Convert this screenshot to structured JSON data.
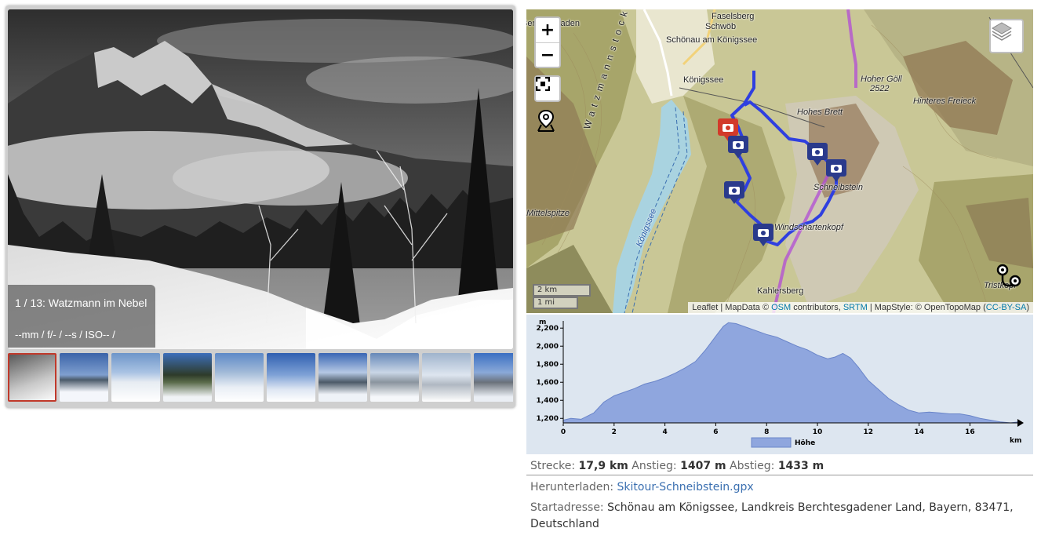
{
  "gallery": {
    "caption_title": "1 / 13: Watzmann im Nebel",
    "caption_meta": "--mm / f/- / --s / ISO-- /",
    "thumbnail_count": 10,
    "active_thumbnail": 1
  },
  "map": {
    "zoom_in": "+",
    "zoom_out": "−",
    "scale_km": "2 km",
    "scale_mi": "1 mi",
    "labels": {
      "faselsberg": "Faselsberg",
      "schwoeb": "Schwöb",
      "schoenau": "Schönau am Königssee",
      "koenigssee_town": "Königssee",
      "hoher_goell": "Hoher Göll",
      "hoher_goell_alt": "2522",
      "hinteres_freieck": "Hinteres Freieck",
      "hohes_brett": "Hohes Brett",
      "schneibstein": "Schneibstein",
      "windschartenkopf": "Windschartenkopf",
      "kahlersberg": "Kahlersberg",
      "mittelspitze": "Mittelspitze",
      "watzmannstock": "Watzmannstock",
      "koenigssee_lake": "Königssee",
      "berchtesgaden": "Berchtesgaden",
      "tristkopf": "Tristkopf"
    },
    "attribution": {
      "leaflet": "Leaflet",
      "mapdata": " | MapData © ",
      "osm": "OSM",
      "contributors": " contributors, ",
      "srtm": "SRTM",
      "mapstyle": " | MapStyle: © OpenTopoMap (",
      "ccbysa": "CC-BY-SA",
      "close": ")"
    }
  },
  "profile": {
    "y_unit": "m",
    "x_unit": "km",
    "legend": "Höhe",
    "y_ticks": [
      "1,200",
      "1,400",
      "1,600",
      "1,800",
      "2,000",
      "2,200"
    ],
    "x_ticks": [
      "0",
      "2",
      "4",
      "6",
      "8",
      "10",
      "12",
      "14",
      "16"
    ],
    "fill_color": "#8fa6de",
    "line_color": "#6a85c9"
  },
  "chart_data": {
    "type": "area",
    "xlabel": "km",
    "ylabel": "m",
    "xlim": [
      0,
      17.9
    ],
    "ylim": [
      1150,
      2280
    ],
    "series": [
      {
        "name": "Höhe",
        "x": [
          0,
          0.3,
          0.7,
          1.2,
          1.6,
          2.0,
          2.4,
          2.8,
          3.2,
          3.6,
          4.0,
          4.4,
          4.8,
          5.2,
          5.6,
          6.0,
          6.3,
          6.5,
          6.8,
          7.2,
          7.6,
          8.0,
          8.4,
          8.8,
          9.2,
          9.6,
          10.0,
          10.4,
          10.7,
          11.0,
          11.3,
          11.6,
          12.0,
          12.4,
          12.8,
          13.2,
          13.6,
          14.0,
          14.4,
          14.8,
          15.2,
          15.6,
          16.0,
          16.4,
          16.8,
          17.2,
          17.6,
          17.9
        ],
        "values": [
          1180,
          1200,
          1190,
          1260,
          1380,
          1450,
          1490,
          1530,
          1580,
          1610,
          1650,
          1700,
          1760,
          1830,
          1960,
          2110,
          2220,
          2260,
          2250,
          2210,
          2170,
          2130,
          2100,
          2050,
          2000,
          1960,
          1900,
          1860,
          1880,
          1920,
          1870,
          1770,
          1620,
          1520,
          1420,
          1350,
          1290,
          1260,
          1270,
          1260,
          1250,
          1250,
          1230,
          1200,
          1180,
          1160,
          1150,
          1160
        ]
      }
    ]
  },
  "stats": {
    "distance_label": "Strecke: ",
    "distance_value": "17,9 km",
    "ascent_label": " Anstieg: ",
    "ascent_value": "1407 m",
    "descent_label": " Abstieg: ",
    "descent_value": "1433 m"
  },
  "download": {
    "label": "Herunterladen: ",
    "file": "Skitour-Schneibstein.gpx"
  },
  "start": {
    "label": "Startadresse: ",
    "address_line1": "Schönau am Königssee, Landkreis Berchtesgadener Land, Bayern, 83471,",
    "address_line2": "Deutschland"
  }
}
